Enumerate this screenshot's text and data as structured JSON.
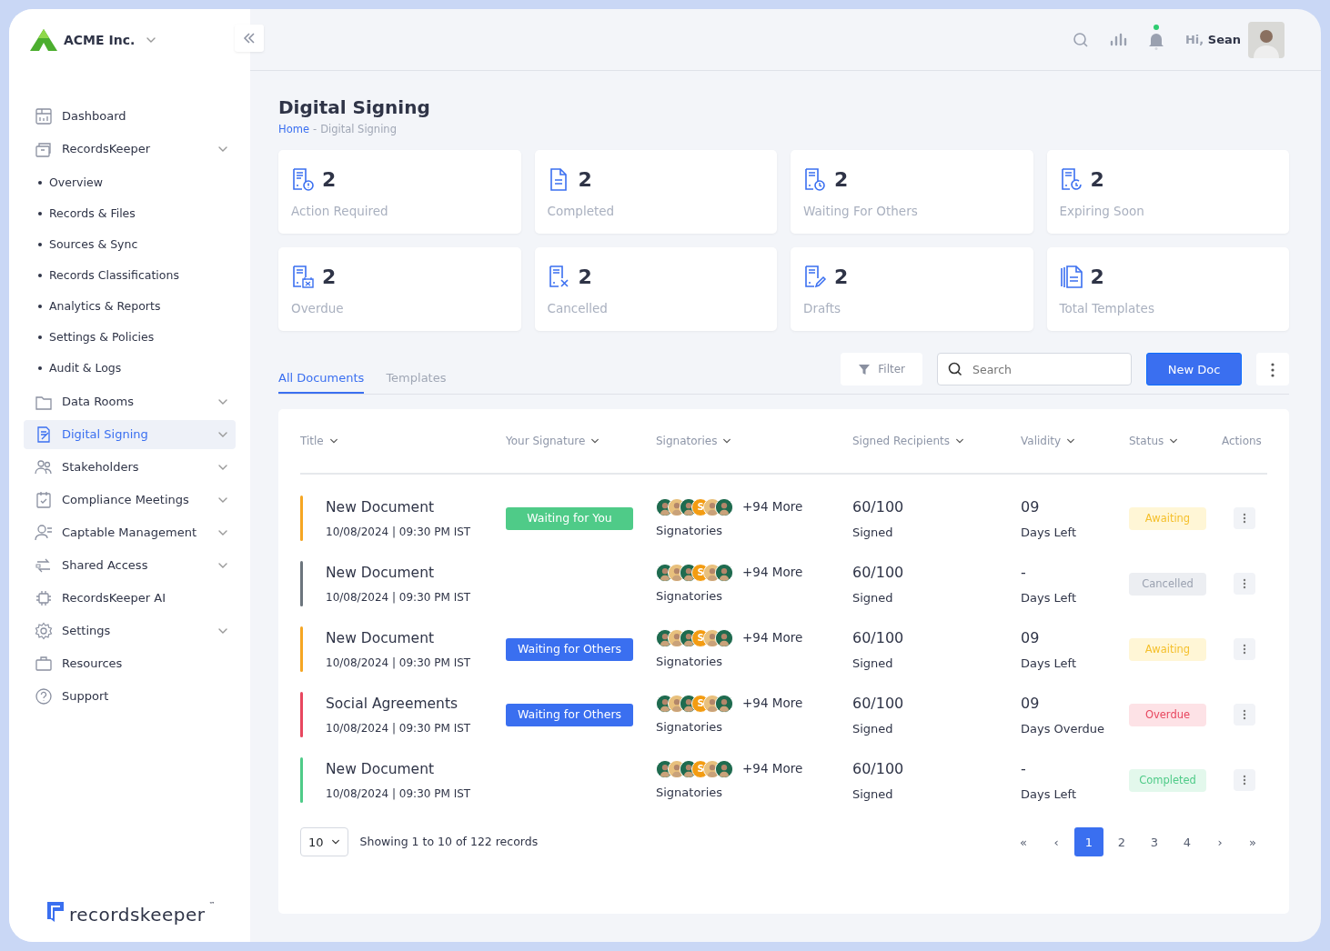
{
  "org": {
    "name": "ACME Inc."
  },
  "sidebar": {
    "items": [
      {
        "label": "Dashboard",
        "has_submenu": false,
        "selected": false
      },
      {
        "label": "RecordsKeeper",
        "has_submenu": true,
        "selected": false,
        "children": [
          {
            "label": "Overview"
          },
          {
            "label": "Records & Files"
          },
          {
            "label": "Sources & Sync"
          },
          {
            "label": "Records Classifications"
          },
          {
            "label": "Analytics & Reports"
          },
          {
            "label": "Settings & Policies"
          },
          {
            "label": "Audit & Logs"
          }
        ]
      },
      {
        "label": "Data Rooms",
        "has_submenu": true,
        "selected": false
      },
      {
        "label": "Digital Signing",
        "has_submenu": true,
        "selected": true
      },
      {
        "label": "Stakeholders",
        "has_submenu": true,
        "selected": false
      },
      {
        "label": "Compliance Meetings",
        "has_submenu": true,
        "selected": false
      },
      {
        "label": "Captable Management",
        "has_submenu": true,
        "selected": false
      },
      {
        "label": "Shared Access",
        "has_submenu": true,
        "selected": false
      },
      {
        "label": "RecordsKeeper AI",
        "has_submenu": false,
        "selected": false
      },
      {
        "label": "Settings",
        "has_submenu": true,
        "selected": false
      },
      {
        "label": "Resources",
        "has_submenu": false,
        "selected": false
      },
      {
        "label": "Support",
        "has_submenu": false,
        "selected": false
      }
    ],
    "brand": {
      "name": "recordskeeper",
      "mark": "™"
    }
  },
  "topbar": {
    "greeting": "Hi,",
    "user": "Sean",
    "notification_dot": true
  },
  "page": {
    "title": "Digital Signing",
    "breadcrumb": [
      {
        "label": "Home",
        "link": true
      },
      {
        "label": "-",
        "link": false
      },
      {
        "label": "Digital Signing",
        "link": false
      }
    ]
  },
  "stats": [
    {
      "value": "2",
      "label": "Action Required"
    },
    {
      "value": "2",
      "label": "Completed"
    },
    {
      "value": "2",
      "label": "Waiting For Others"
    },
    {
      "value": "2",
      "label": "Expiring Soon"
    },
    {
      "value": "2",
      "label": "Overdue"
    },
    {
      "value": "2",
      "label": "Cancelled"
    },
    {
      "value": "2",
      "label": "Drafts"
    },
    {
      "value": "2",
      "label": "Total Templates"
    }
  ],
  "tabs": [
    {
      "label": "All Documents",
      "selected": true
    },
    {
      "label": "Templates",
      "selected": false
    }
  ],
  "toolbar": {
    "filter": "Filter",
    "search_placeholder": "Search",
    "new_button": "New Doc"
  },
  "table": {
    "columns": [
      {
        "label": "Title",
        "sortable": true
      },
      {
        "label": "Your Signature",
        "sortable": true
      },
      {
        "label": "Signatories",
        "sortable": true
      },
      {
        "label": "Signed Recipients",
        "sortable": true
      },
      {
        "label": "Validity",
        "sortable": true
      },
      {
        "label": "Status",
        "sortable": true
      },
      {
        "label": "Actions",
        "sortable": false
      }
    ],
    "rows": [
      {
        "color": "#f5a623",
        "title": "New Document",
        "date": "10/08/2024 | 09:30 PM IST",
        "signature": {
          "kind": "you",
          "label": "Waiting for You"
        },
        "avatar_initial": "S",
        "more": "+94 More",
        "signatories": "Signatories",
        "signed": "60/100",
        "signed_label": "Signed",
        "validity": "09",
        "validity_label": "Days Left",
        "status": {
          "kind": "awaiting",
          "label": "Awaiting"
        }
      },
      {
        "color": "#6c757d",
        "title": "New Document",
        "date": "10/08/2024 | 09:30 PM IST",
        "avatar_initial": "S",
        "more": "+94 More",
        "signatories": "Signatories",
        "signed": "60/100",
        "signed_label": "Signed",
        "validity": "-",
        "validity_label": "Days Left",
        "status": {
          "kind": "cancelled",
          "label": "Cancelled"
        }
      },
      {
        "color": "#f5a623",
        "title": "New Document",
        "date": "10/08/2024 | 09:30 PM IST",
        "signature": {
          "kind": "others",
          "label": "Waiting for Others"
        },
        "avatar_initial": "S",
        "more": "+94 More",
        "signatories": "Signatories",
        "signed": "60/100",
        "signed_label": "Signed",
        "validity": "09",
        "validity_label": "Days Left",
        "status": {
          "kind": "awaiting",
          "label": "Awaiting"
        }
      },
      {
        "color": "#e8475f",
        "title": "Social Agreements",
        "date": "10/08/2024 | 09:30 PM IST",
        "signature": {
          "kind": "others",
          "label": "Waiting for Others"
        },
        "avatar_initial": "S",
        "more": "+94 More",
        "signatories": "Signatories",
        "signed": "60/100",
        "signed_label": "Signed",
        "validity": "09",
        "validity_label": "Days Overdue",
        "status": {
          "kind": "overdue",
          "label": "Overdue"
        }
      },
      {
        "color": "#4fcb88",
        "title": "New Document",
        "date": "10/08/2024 | 09:30 PM IST",
        "avatar_initial": "S",
        "more": "+94 More",
        "signatories": "Signatories",
        "signed": "60/100",
        "signed_label": "Signed",
        "validity": "-",
        "validity_label": "Days Left",
        "status": {
          "kind": "completed",
          "label": "Completed"
        }
      }
    ]
  },
  "footer": {
    "page_size": "10",
    "summary": "Showing 1 to 10 of 122 records",
    "first": "«",
    "prev": "‹",
    "pages": [
      {
        "label": "1",
        "selected": true
      },
      {
        "label": "2",
        "selected": false
      },
      {
        "label": "3",
        "selected": false
      },
      {
        "label": "4",
        "selected": false
      }
    ],
    "next": "›",
    "last": "»"
  }
}
